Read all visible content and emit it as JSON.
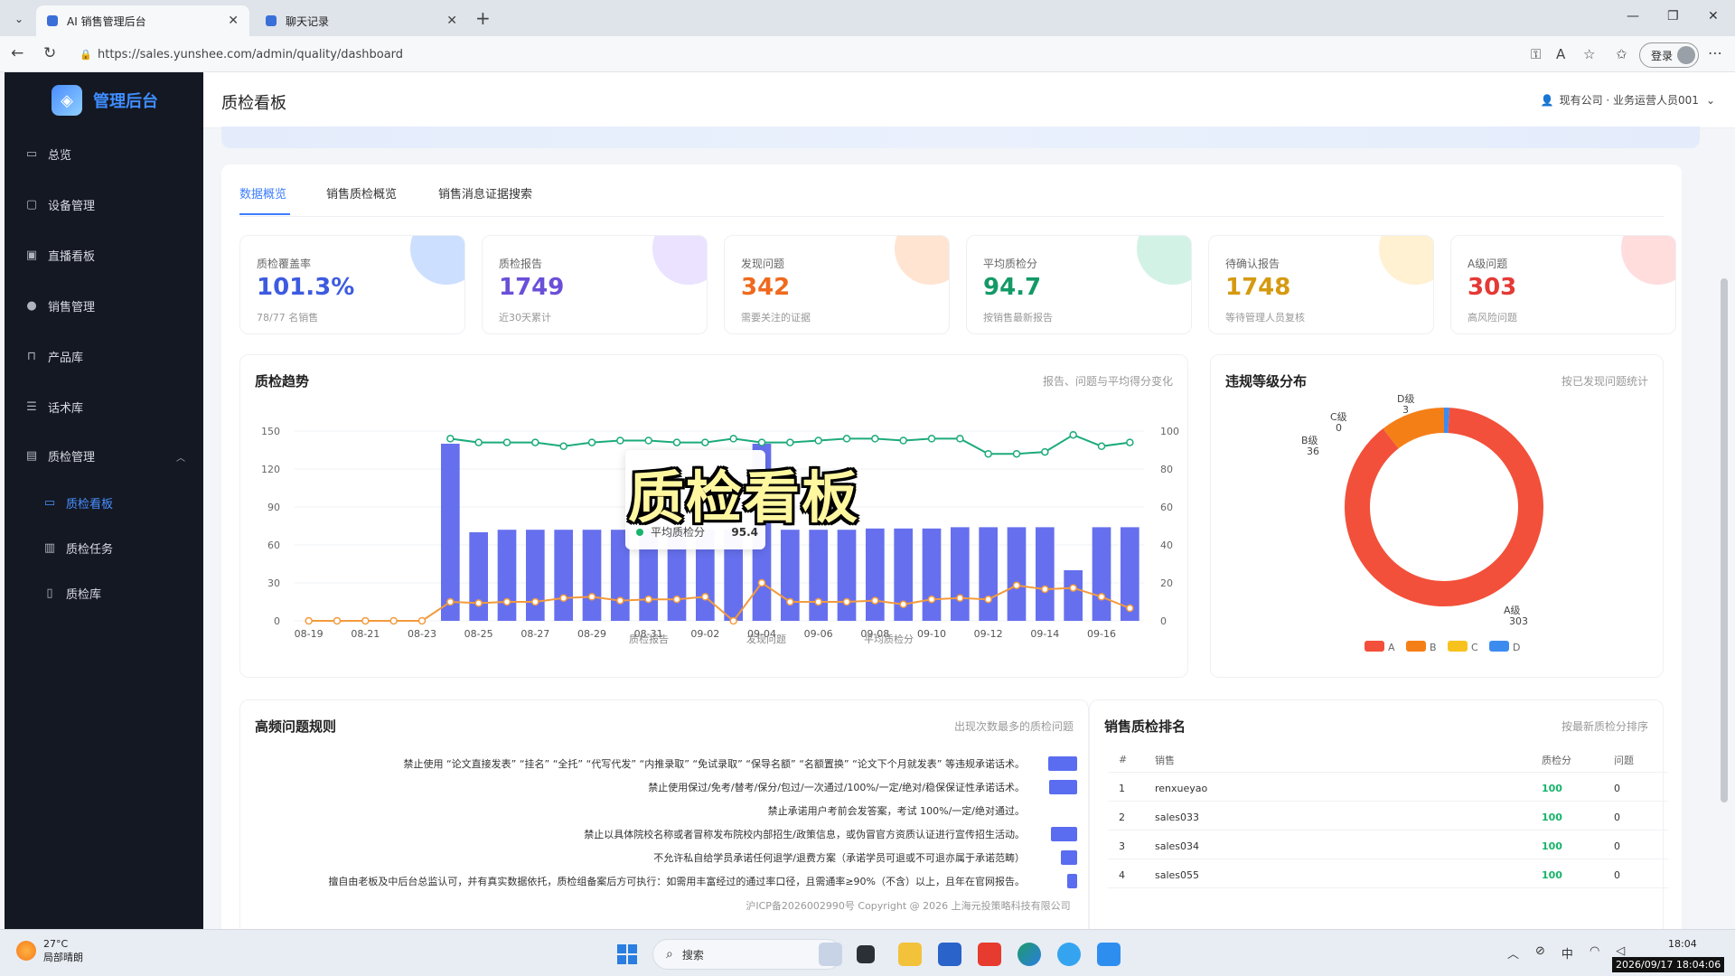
{
  "browser": {
    "tabs": [
      {
        "title": "AI 销售管理后台",
        "active": true
      },
      {
        "title": "聊天记录",
        "active": false
      }
    ],
    "url": "https://sales.yunshee.com/admin/quality/dashboard",
    "login_label": "登录"
  },
  "sidebar": {
    "brand": "管理后台",
    "items": [
      {
        "label": "总览",
        "icon": "monitor-icon"
      },
      {
        "label": "设备管理",
        "icon": "device-icon"
      },
      {
        "label": "直播看板",
        "icon": "live-icon"
      },
      {
        "label": "销售管理",
        "icon": "user-icon"
      },
      {
        "label": "产品库",
        "icon": "bag-icon"
      },
      {
        "label": "话术库",
        "icon": "script-icon"
      },
      {
        "label": "质检管理",
        "icon": "doc-check-icon"
      }
    ],
    "subitems": [
      {
        "label": "质检看板",
        "icon": "dashboard-icon",
        "active": true
      },
      {
        "label": "质检任务",
        "icon": "task-icon"
      },
      {
        "label": "质检库",
        "icon": "library-icon"
      }
    ]
  },
  "header": {
    "title": "质检看板",
    "company": "现有公司 · 业务运营人员001"
  },
  "tabs": [
    "数据概览",
    "销售质检概览",
    "销售消息证据搜索"
  ],
  "kpis": [
    {
      "label": "质检覆盖率",
      "value": "101.3%",
      "sub": "78/77 名销售",
      "color": "#3d5be0",
      "blob": "#9cc0ff"
    },
    {
      "label": "质检报告",
      "value": "1749",
      "sub": "近30天累计",
      "color": "#6b4fd8",
      "blob": "#d5c6ff"
    },
    {
      "label": "发现问题",
      "value": "342",
      "sub": "需要关注的证据",
      "color": "#ef6a1e",
      "blob": "#ffc9a6"
    },
    {
      "label": "平均质检分",
      "value": "94.7",
      "sub": "按销售最新报告",
      "color": "#139a66",
      "blob": "#a6e6cb"
    },
    {
      "label": "待确认报告",
      "value": "1748",
      "sub": "等待管理人员复核",
      "color": "#d59a10",
      "blob": "#ffe3a3"
    },
    {
      "label": "A级问题",
      "value": "303",
      "sub": "高风险问题",
      "color": "#e53935",
      "blob": "#ffbcbc"
    }
  ],
  "trend": {
    "title": "质检趋势",
    "hint": "报告、问题与平均得分变化",
    "tooltip": {
      "label": "平均质检分",
      "value": "95.4"
    },
    "legend": [
      "质检报告",
      "发现问题",
      "平均质检分"
    ]
  },
  "chart_data": [
    {
      "type": "bar",
      "title": "质检趋势",
      "categories": [
        "08-19",
        "08-20",
        "08-21",
        "08-22",
        "08-23",
        "08-24",
        "08-25",
        "08-26",
        "08-27",
        "08-28",
        "08-29",
        "08-30",
        "08-31",
        "09-01",
        "09-02",
        "09-03",
        "09-04",
        "09-05",
        "09-06",
        "09-07",
        "09-08",
        "09-09",
        "09-10",
        "09-11",
        "09-12",
        "09-13",
        "09-14",
        "09-15",
        "09-16",
        "09-17"
      ],
      "tick_labels": [
        "08-19",
        "08-21",
        "08-23",
        "08-25",
        "08-27",
        "08-29",
        "08-31",
        "09-02",
        "09-04",
        "09-06",
        "09-08",
        "09-10",
        "09-12",
        "09-14",
        "09-16"
      ],
      "series": [
        {
          "name": "质检报告",
          "kind": "bar",
          "axis": "left",
          "color": "#6670ee",
          "values": [
            0,
            0,
            0,
            0,
            0,
            140,
            70,
            72,
            72,
            72,
            72,
            72,
            72,
            72,
            72,
            72,
            140,
            72,
            72,
            72,
            73,
            73,
            73,
            74,
            74,
            74,
            74,
            40,
            74,
            74
          ]
        },
        {
          "name": "发现问题",
          "kind": "line",
          "axis": "left",
          "color": "#f39a3c",
          "values": [
            0,
            0,
            0,
            0,
            0,
            15,
            14,
            15,
            15,
            18,
            19,
            16,
            17,
            17,
            19,
            0,
            30,
            15,
            15,
            15,
            16,
            13,
            17,
            18,
            17,
            28,
            25,
            26,
            19,
            10
          ]
        },
        {
          "name": "平均质检分",
          "kind": "line",
          "axis": "right",
          "color": "#1cab7a",
          "values": [
            null,
            null,
            null,
            null,
            null,
            96,
            94,
            94,
            94,
            92,
            94,
            95,
            95,
            94,
            94,
            96,
            94,
            94,
            95,
            96,
            96,
            95,
            96,
            96,
            88,
            88,
            89,
            98,
            92,
            94
          ]
        }
      ],
      "y_left": {
        "ticks": [
          0,
          30,
          60,
          90,
          120,
          150
        ],
        "range": [
          0,
          150
        ]
      },
      "y_right": {
        "ticks": [
          0,
          20,
          40,
          60,
          80,
          100
        ],
        "range": [
          0,
          100
        ]
      }
    },
    {
      "type": "pie",
      "title": "违规等级分布",
      "hint": "按已发现问题统计",
      "slices": [
        {
          "label": "A级",
          "value": 303,
          "color": "#f2503a"
        },
        {
          "label": "B级",
          "value": 36,
          "color": "#f57f17"
        },
        {
          "label": "C级",
          "value": 0,
          "color": "#f7c21e"
        },
        {
          "label": "D级",
          "value": 3,
          "color": "#3c8cf0"
        }
      ],
      "legend": [
        "A",
        "B",
        "C",
        "D"
      ]
    }
  ],
  "rules": {
    "title": "高频问题规则",
    "hint": "出现次数最多的质检问题",
    "lines": [
      {
        "text": "禁止使用 “论文直接发表” “挂名” “全托” “代写代发” “内推录取” “免试录取” “保导名额” “名额置换” “论文下个月就发表” 等违规承诺话术。",
        "bar": 0.9
      },
      {
        "text": "禁止使用保过/免考/替考/保分/包过/一次通过/100%/一定/绝对/稳保保证性承诺话术。",
        "bar": 0.85
      },
      {
        "text": "禁止承诺用户考前会发答案，考试 100%/一定/绝对通过。",
        "bar": 0.0
      },
      {
        "text": "禁止以具体院校名称或者冒称发布院校内部招生/政策信息，或伪冒官方资质认证进行宣传招生活动。",
        "bar": 0.8
      },
      {
        "text": "不允许私自给学员承诺任何退学/退费方案（承诺学员可退或不可退亦属于承诺范畴）",
        "bar": 0.5
      },
      {
        "text": "擅自由老板及中后台总监认可，并有真实数据依托，质检组备案后方可执行：如需用丰富经过的通过率口径，且需通率≥90%（不含）以上，且年在官网报告。",
        "bar": 0.3
      }
    ]
  },
  "ranking": {
    "title": "销售质检排名",
    "hint": "按最新质检分排序",
    "columns": [
      "#",
      "销售",
      "质检分",
      "问题"
    ],
    "rows": [
      {
        "rank": "1",
        "name": "renxueyao",
        "score": "100",
        "issues": "0"
      },
      {
        "rank": "2",
        "name": "sales033",
        "score": "100",
        "issues": "0"
      },
      {
        "rank": "3",
        "name": "sales034",
        "score": "100",
        "issues": "0"
      },
      {
        "rank": "4",
        "name": "sales055",
        "score": "100",
        "issues": "0"
      }
    ]
  },
  "overlay_caption": "质检看板",
  "footer": "沪ICP备2026002990号    Copyright @ 2026 上海元投策略科技有限公司",
  "taskbar": {
    "weather_temp": "27°C",
    "weather_desc": "局部晴朗",
    "search_label": "搜索",
    "tray_lang": "中",
    "time": "18:04",
    "stamp": "2026/09/17 18:04:06"
  }
}
